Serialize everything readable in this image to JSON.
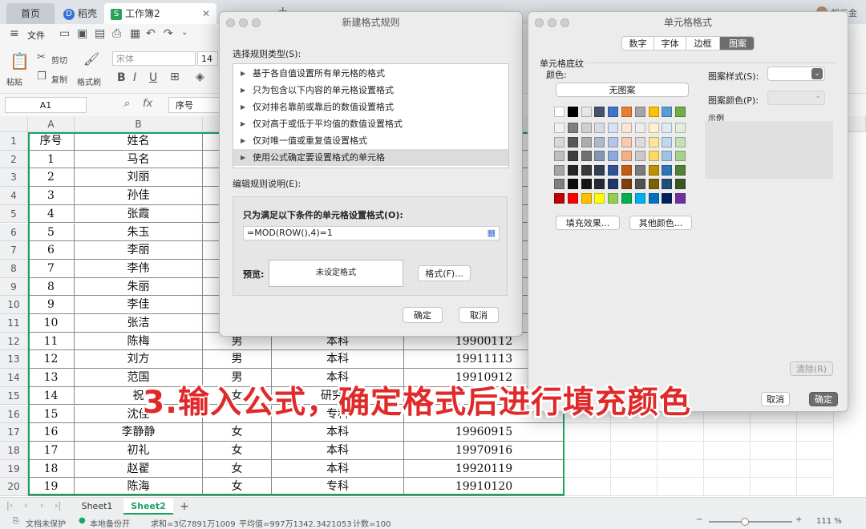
{
  "tabs": {
    "home": "首页",
    "daoke": "稻壳",
    "workbook": "工作簿2",
    "user": "胡三金"
  },
  "menu": {
    "file": "文件"
  },
  "ribbon": {
    "paste": "粘贴",
    "cut": "剪切",
    "copy": "复制",
    "format_painter": "格式刷",
    "font_name": "宋体",
    "font_size": "14"
  },
  "formula_bar": {
    "cell_ref": "A1",
    "fx": "fx",
    "content": "序号"
  },
  "columns": [
    "A",
    "B"
  ],
  "rows": [
    {
      "n": "1",
      "seq": "序号",
      "name": "姓名",
      "gender": "",
      "edu": "",
      "date": ""
    },
    {
      "n": "2",
      "seq": "1",
      "name": "马名",
      "gender": "",
      "edu": "",
      "date": ""
    },
    {
      "n": "3",
      "seq": "2",
      "name": "刘丽",
      "gender": "",
      "edu": "",
      "date": ""
    },
    {
      "n": "4",
      "seq": "3",
      "name": "孙佳",
      "gender": "",
      "edu": "",
      "date": ""
    },
    {
      "n": "5",
      "seq": "4",
      "name": "张霞",
      "gender": "",
      "edu": "",
      "date": ""
    },
    {
      "n": "6",
      "seq": "5",
      "name": "朱玉",
      "gender": "",
      "edu": "",
      "date": ""
    },
    {
      "n": "7",
      "seq": "6",
      "name": "李丽",
      "gender": "",
      "edu": "",
      "date": ""
    },
    {
      "n": "8",
      "seq": "7",
      "name": "李伟",
      "gender": "",
      "edu": "",
      "date": ""
    },
    {
      "n": "9",
      "seq": "8",
      "name": "朱丽",
      "gender": "",
      "edu": "",
      "date": ""
    },
    {
      "n": "10",
      "seq": "9",
      "name": "李佳",
      "gender": "",
      "edu": "",
      "date": ""
    },
    {
      "n": "11",
      "seq": "10",
      "name": "张洁",
      "gender": "",
      "edu": "",
      "date": ""
    },
    {
      "n": "12",
      "seq": "11",
      "name": "陈梅",
      "gender": "男",
      "edu": "本科",
      "date": "19900112"
    },
    {
      "n": "13",
      "seq": "12",
      "name": "刘方",
      "gender": "男",
      "edu": "本科",
      "date": "19911113"
    },
    {
      "n": "14",
      "seq": "13",
      "name": "范国",
      "gender": "男",
      "edu": "本科",
      "date": "19910912"
    },
    {
      "n": "15",
      "seq": "14",
      "name": "祝",
      "gender": "女",
      "edu": "研究生",
      "date": ""
    },
    {
      "n": "16",
      "seq": "15",
      "name": "沈佳",
      "gender": "",
      "edu": "专科",
      "date": ""
    },
    {
      "n": "17",
      "seq": "16",
      "name": "李静静",
      "gender": "女",
      "edu": "本科",
      "date": "19960915"
    },
    {
      "n": "18",
      "seq": "17",
      "name": "初礼",
      "gender": "女",
      "edu": "本科",
      "date": "19970916"
    },
    {
      "n": "19",
      "seq": "18",
      "name": "赵翟",
      "gender": "女",
      "edu": "本科",
      "date": "19920119"
    },
    {
      "n": "20",
      "seq": "19",
      "name": "陈海",
      "gender": "女",
      "edu": "专科",
      "date": "19910120"
    }
  ],
  "sheets": {
    "s1": "Sheet1",
    "s2": "Sheet2",
    "add": "+"
  },
  "status": {
    "protect": "文档未保护",
    "backup": "本地备份开",
    "sum": "求和=3亿7891万1009",
    "avg": "平均值=997万1342.3421053",
    "count": "计数=100",
    "zoom": "111 %"
  },
  "new_rule_dialog": {
    "title": "新建格式规则",
    "select_type_label": "选择规则类型(S):",
    "rule_types": [
      "基于各自值设置所有单元格的格式",
      "只为包含以下内容的单元格设置格式",
      "仅对排名靠前或靠后的数值设置格式",
      "仅对高于或低于平均值的数值设置格式",
      "仅对唯一值或重复值设置格式",
      "使用公式确定要设置格式的单元格"
    ],
    "edit_label": "编辑规则说明(E):",
    "condition_label": "只为满足以下条件的单元格设置格式(O):",
    "formula": "=MOD(ROW(),4)=1",
    "preview_label": "预览:",
    "preview_text": "未设定格式",
    "format_button": "格式(F)...",
    "ok": "确定",
    "cancel": "取消"
  },
  "cell_format_dialog": {
    "title": "单元格格式",
    "tabs": [
      "数字",
      "字体",
      "边框",
      "图案"
    ],
    "section": "单元格底纹",
    "color_label": "颜色:",
    "no_pattern": "无图案",
    "fill_effect": "填充效果...",
    "other_colors": "其他颜色...",
    "pattern_style_label": "图案样式(S):",
    "pattern_color_label": "图案颜色(P):",
    "sample_label": "示例",
    "clear": "清除(R)",
    "cancel": "取消",
    "ok": "确定"
  },
  "palette": {
    "row0": [
      "#ffffff",
      "#000000",
      "#e7e6e6",
      "#44546a",
      "#4472c4",
      "#ed7d31",
      "#a5a5a5",
      "#ffc000",
      "#5b9bd5",
      "#70ad47"
    ],
    "tints": [
      [
        "#f2f2f2",
        "#7f7f7f",
        "#d0cece",
        "#d6dce4",
        "#d9e2f3",
        "#fbe5d5",
        "#ededed",
        "#fff2cc",
        "#deeaf6",
        "#e2efd9"
      ],
      [
        "#d8d8d8",
        "#595959",
        "#aeabab",
        "#adb9ca",
        "#b4c6e7",
        "#f7cbac",
        "#dbdbdb",
        "#fee599",
        "#bdd7ee",
        "#c5e0b3"
      ],
      [
        "#bfbfbf",
        "#3f3f3f",
        "#757070",
        "#8496b0",
        "#8eaadb",
        "#f4b183",
        "#c9c9c9",
        "#ffd965",
        "#9cc3e5",
        "#a8d08d"
      ],
      [
        "#a5a5a5",
        "#262626",
        "#3a3838",
        "#323f4f",
        "#2f5496",
        "#c55a11",
        "#7b7b7b",
        "#bf9000",
        "#2e75b5",
        "#538135"
      ],
      [
        "#7f7f7f",
        "#0c0c0c",
        "#171616",
        "#222a35",
        "#1f3864",
        "#833c0b",
        "#525252",
        "#7f6000",
        "#1f4e79",
        "#375623"
      ]
    ],
    "standard": [
      "#c00000",
      "#ff0000",
      "#ffc000",
      "#ffff00",
      "#92d050",
      "#00b050",
      "#00b0f0",
      "#0070c0",
      "#002060",
      "#7030a0"
    ]
  },
  "caption": "3.输入公式，确定格式后进行填充颜色",
  "colors": {
    "accent_green": "#1aa462",
    "caption_red": "#e02a2a"
  }
}
